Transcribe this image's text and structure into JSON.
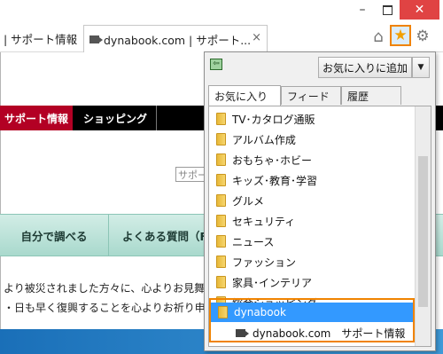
{
  "window": {
    "minimize_symbol": "–",
    "close_symbol": "✕"
  },
  "tabs": [
    {
      "label": "| サポート情報"
    },
    {
      "label": "dynabook.com | サポート...",
      "close": "×"
    }
  ],
  "toolbar": {
    "home_icon": "⌂",
    "favorites_icon": "★",
    "tools_icon": "⚙"
  },
  "page": {
    "nav": {
      "active": "サポート情報",
      "item": "ショッピング"
    },
    "search_placeholder": "サポー",
    "menu": [
      "自分で調べる",
      "よくある質問（F"
    ],
    "lines": [
      "より被災されました方々に、心よりお見舞",
      "・日も早く復興することを心よりお祈り申し"
    ]
  },
  "favorites_panel": {
    "pin_icon": "⇦",
    "add_button": "お気に入りに追加",
    "add_dropdown": "▼",
    "tabs": [
      "お気に入り",
      "フィード",
      "履歴"
    ],
    "folders": [
      "TV･カタログ通販",
      "アルバム作成",
      "おもちゃ･ホビー",
      "キッズ･教育･学習",
      "グルメ",
      "セキュリティ",
      "ニュース",
      "ファッション",
      "家具･インテリア",
      "総合ショッピング",
      "dynabook"
    ],
    "selected_folder": "dynabook",
    "link": "dynabook.com　サポート情報"
  },
  "colors": {
    "accent_orange": "#f08300",
    "selection_blue": "#3399ff",
    "nav_red": "#b30024"
  }
}
